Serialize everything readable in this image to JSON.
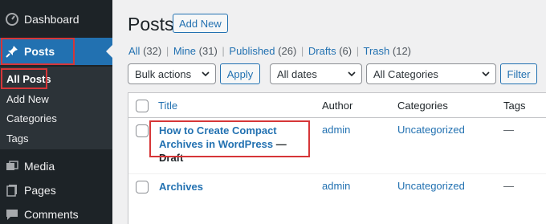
{
  "sidebar": {
    "dashboard_label": "Dashboard",
    "posts_label": "Posts",
    "submenu": [
      "All Posts",
      "Add New",
      "Categories",
      "Tags"
    ],
    "media_label": "Media",
    "pages_label": "Pages",
    "comments_label": "Comments"
  },
  "header": {
    "title": "Posts",
    "add_new_label": "Add New"
  },
  "filters_links": [
    {
      "label": "All",
      "count": "(32)"
    },
    {
      "label": "Mine",
      "count": "(31)"
    },
    {
      "label": "Published",
      "count": "(26)"
    },
    {
      "label": "Drafts",
      "count": "(6)"
    },
    {
      "label": "Trash",
      "count": "(12)"
    }
  ],
  "toolbar": {
    "bulk_actions": "Bulk actions",
    "apply_label": "Apply",
    "dates": "All dates",
    "categories": "All Categories",
    "filter_label": "Filter"
  },
  "table": {
    "columns": [
      "Title",
      "Author",
      "Categories",
      "Tags"
    ],
    "rows": [
      {
        "title_line1": "How to Create Compact",
        "title_line2": "Archives in WordPress",
        "state": "— Draft",
        "author": "admin",
        "category": "Uncategorized",
        "tags": "—"
      },
      {
        "title_line1": "Archives",
        "author": "admin",
        "category": "Uncategorized",
        "tags": "—"
      }
    ]
  },
  "colors": {
    "sidebar_bg": "#1d2327",
    "accent": "#2271b1",
    "highlight": "#d63638"
  }
}
